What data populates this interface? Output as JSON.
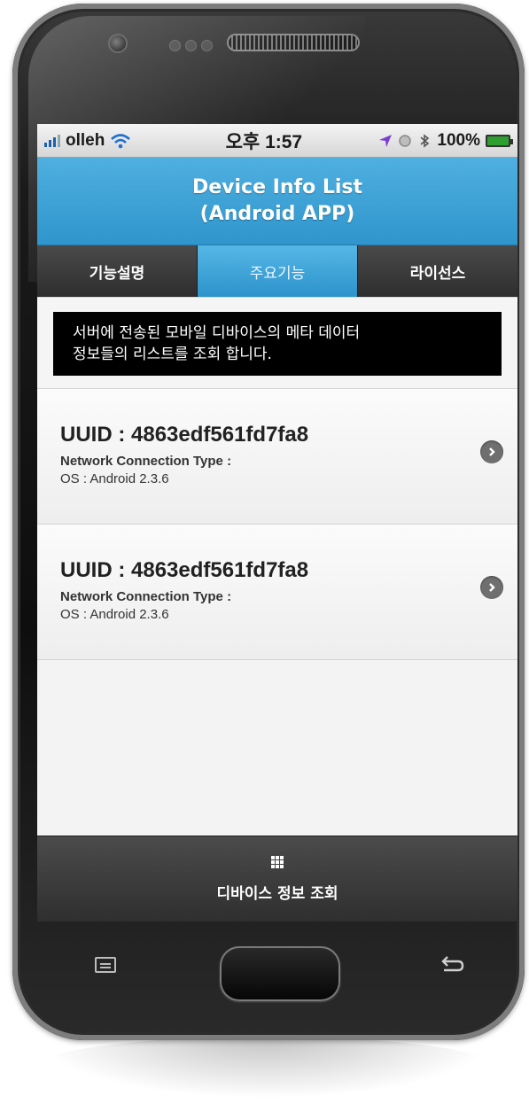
{
  "status_bar": {
    "carrier": "olleh",
    "time": "오후 1:57",
    "battery": "100%"
  },
  "header": {
    "title_line1": "Device Info List",
    "title_line2": "(Android APP)"
  },
  "tabs": [
    {
      "label": "기능설명",
      "active": false
    },
    {
      "label": "주요기능",
      "active": true
    },
    {
      "label": "라이선스",
      "active": false
    }
  ],
  "notice": {
    "line1": "서버에 전송된 모바일 디바이스의 메타 데이터",
    "line2": "정보들의 리스트를 조회 합니다."
  },
  "devices": [
    {
      "uuid": "UUID : 4863edf561fd7fa8",
      "network": "Network Connection Type :",
      "os": "OS : Android 2.3.6"
    },
    {
      "uuid": "UUID : 4863edf561fd7fa8",
      "network": "Network Connection Type :",
      "os": "OS : Android 2.3.6"
    }
  ],
  "footer": {
    "icon": "grid-icon",
    "label": "디바이스 정보 조회"
  },
  "colors": {
    "header_blue": "#2f95cc",
    "tab_dark": "#2e2e2e",
    "notice_bg": "#000000"
  }
}
